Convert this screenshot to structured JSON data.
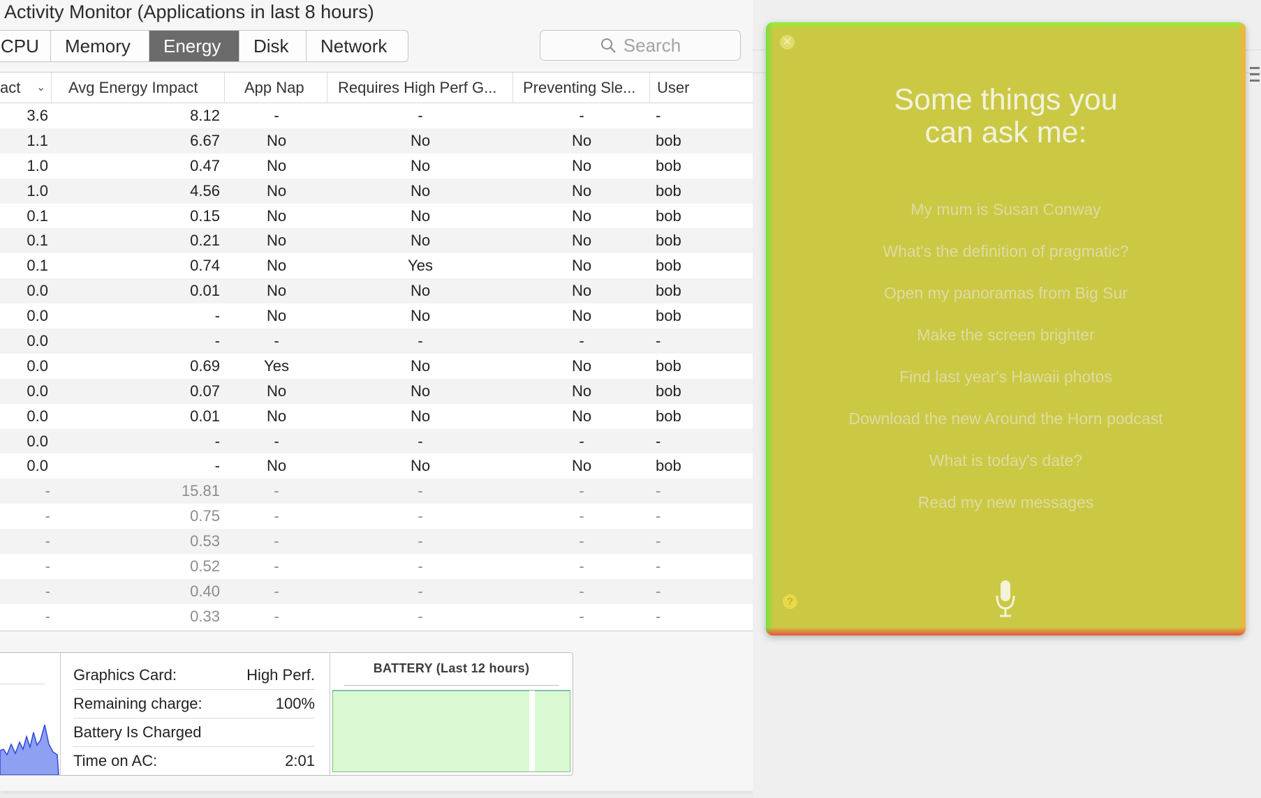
{
  "window": {
    "title": "Activity Monitor (Applications in last 8 hours)"
  },
  "tabs": [
    {
      "label": "CPU"
    },
    {
      "label": "Memory"
    },
    {
      "label": "Energy"
    },
    {
      "label": "Disk"
    },
    {
      "label": "Network"
    }
  ],
  "search": {
    "placeholder": "Search"
  },
  "columns": [
    "act",
    "Avg Energy Impact",
    "App Nap",
    "Requires High Perf G...",
    "Preventing Sle...",
    "User"
  ],
  "rows": [
    [
      "3.6",
      "8.12",
      "-",
      "-",
      "-",
      "-"
    ],
    [
      "1.1",
      "6.67",
      "No",
      "No",
      "No",
      "bob"
    ],
    [
      "1.0",
      "0.47",
      "No",
      "No",
      "No",
      "bob"
    ],
    [
      "1.0",
      "4.56",
      "No",
      "No",
      "No",
      "bob"
    ],
    [
      "0.1",
      "0.15",
      "No",
      "No",
      "No",
      "bob"
    ],
    [
      "0.1",
      "0.21",
      "No",
      "No",
      "No",
      "bob"
    ],
    [
      "0.1",
      "0.74",
      "No",
      "Yes",
      "No",
      "bob"
    ],
    [
      "0.0",
      "0.01",
      "No",
      "No",
      "No",
      "bob"
    ],
    [
      "0.0",
      "-",
      "No",
      "No",
      "No",
      "bob"
    ],
    [
      "0.0",
      "-",
      "-",
      "-",
      "-",
      "-"
    ],
    [
      "0.0",
      "0.69",
      "Yes",
      "No",
      "No",
      "bob"
    ],
    [
      "0.0",
      "0.07",
      "No",
      "No",
      "No",
      "bob"
    ],
    [
      "0.0",
      "0.01",
      "No",
      "No",
      "No",
      "bob"
    ],
    [
      "0.0",
      "-",
      "-",
      "-",
      "-",
      "-"
    ],
    [
      "0.0",
      "-",
      "No",
      "No",
      "No",
      "bob"
    ],
    [
      "-",
      "15.81",
      "-",
      "-",
      "-",
      "-"
    ],
    [
      "-",
      "0.75",
      "-",
      "-",
      "-",
      "-"
    ],
    [
      "-",
      "0.53",
      "-",
      "-",
      "-",
      "-"
    ],
    [
      "-",
      "0.52",
      "-",
      "-",
      "-",
      "-"
    ],
    [
      "-",
      "0.40",
      "-",
      "-",
      "-",
      "-"
    ],
    [
      "-",
      "0.33",
      "-",
      "-",
      "-",
      "-"
    ]
  ],
  "dim_rows_from": 15,
  "info": {
    "graphics_label": "Graphics Card:",
    "graphics_value": "High Perf.",
    "remaining_label": "Remaining charge:",
    "remaining_value": "100%",
    "charged_label": "Battery Is Charged",
    "time_label": "Time on AC:",
    "time_value": "2:01"
  },
  "battery": {
    "title": "BATTERY (Last 12 hours)"
  },
  "siri": {
    "title_line1": "Some things you",
    "title_line2": "can ask me:",
    "suggestions": [
      "My mum is Susan Conway",
      "What's the definition of pragmatic?",
      "Open my panoramas from Big Sur",
      "Make the screen brighter",
      "Find last year's Hawaii photos",
      "Download the new Around the Horn podcast",
      "What is today's date?",
      "Read my new messages"
    ],
    "close_glyph": "✕",
    "help_glyph": "?"
  },
  "colors": {
    "siri_bg": "#cbc844",
    "tab_active": "#6b6b6b",
    "battery_fill": "#d9f9d3",
    "graph_fill": "#8ea0f2"
  },
  "icons": [
    "search-icon",
    "sort-arrow-icon",
    "close-icon",
    "help-icon",
    "microphone-icon",
    "menu-icon"
  ]
}
